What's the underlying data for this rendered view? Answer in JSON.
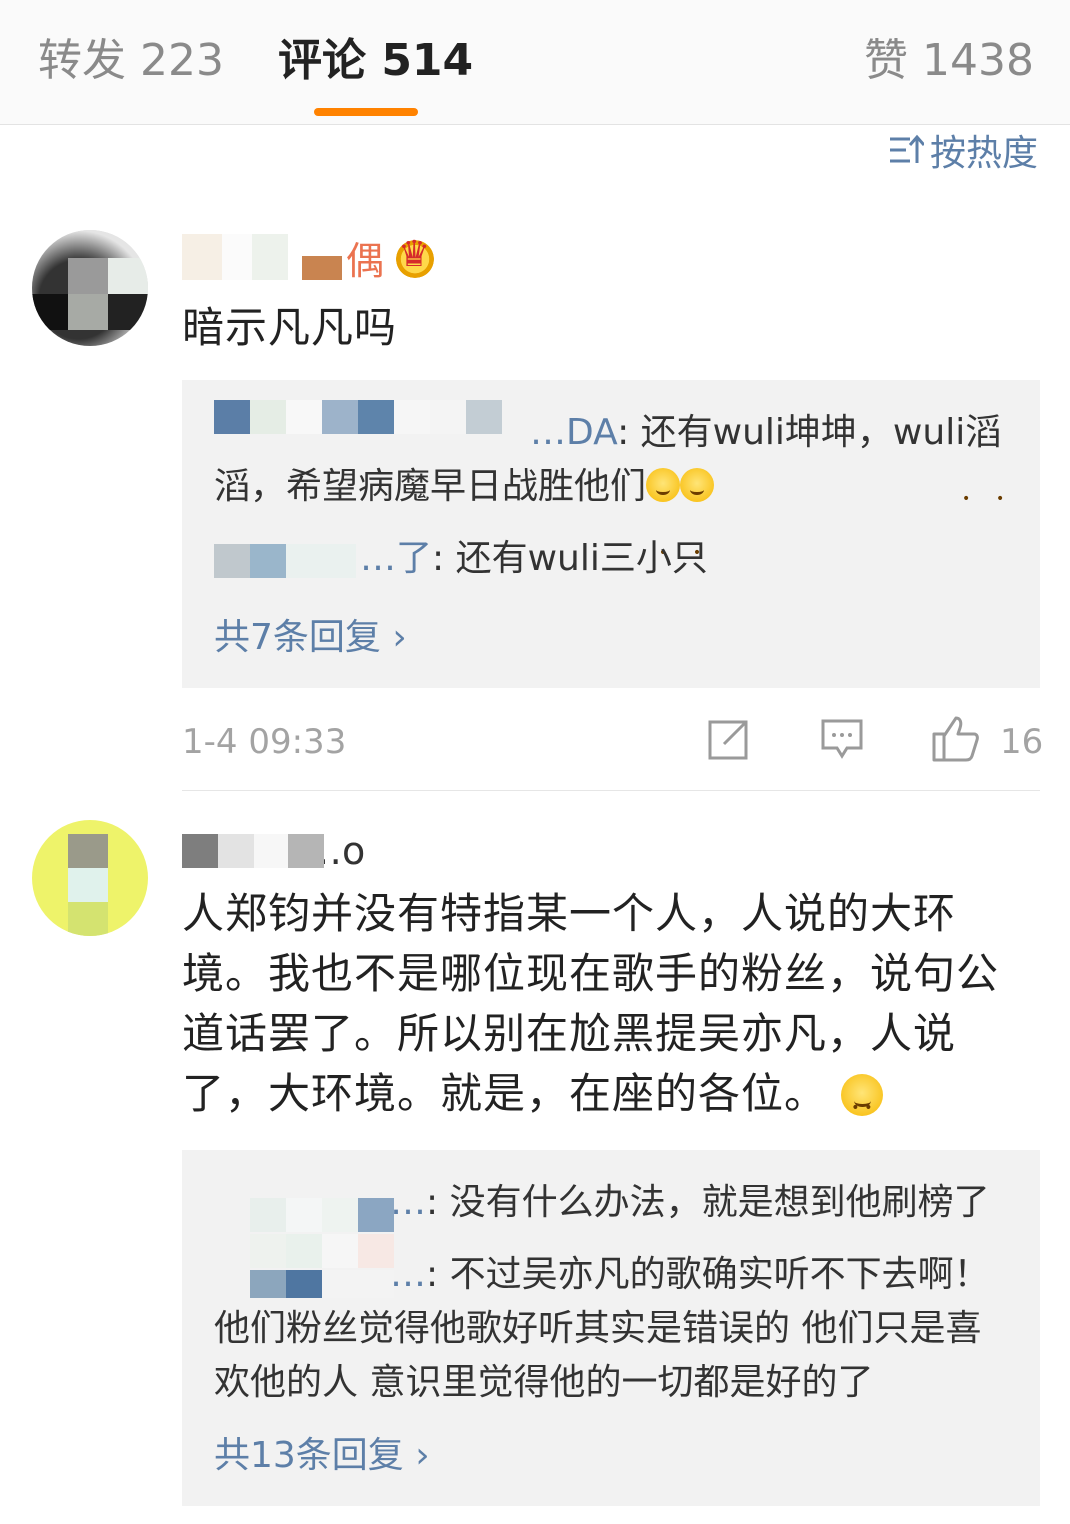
{
  "tabs": {
    "repost": "转发 223",
    "comments": "评论 514",
    "likes": "赞 1438"
  },
  "sort": {
    "label": "按热度",
    "icon": "sort-hot-icon"
  },
  "comments": [
    {
      "name": "…偶",
      "badge_icon": "crown-badge-icon",
      "text": "暗示凡凡吗",
      "replies": [
        {
          "name": "…DA",
          "text": ": 还有wuli坤坤，wuli滔滔，希望病魔早日战胜他们",
          "emoji": "shy-emoji-icon"
        },
        {
          "name": "…了",
          "text": ": 还有wuli三小只"
        }
      ],
      "more_replies": "共7条回复 ›",
      "time": "1-4 09:33",
      "likes": "16"
    },
    {
      "name": "…o",
      "text": "人郑钧并没有特指某一个人，人说的大环境。我也不是哪位现在歌手的粉丝，说句公道话罢了。所以别在尬黑提吴亦凡，人说了，大环境。就是，在座的各位。",
      "emoji": "smile-emoji-icon",
      "replies": [
        {
          "name": "…",
          "text": ": 没有什么办法，就是想到他刷榜了"
        },
        {
          "name": "…",
          "text": ": 不过吴亦凡的歌确实听不下去啊！他们粉丝觉得他歌好听其实是错误的 他们只是喜欢他的人 意识里觉得他的一切都是好的了"
        }
      ],
      "more_replies": "共13条回复 ›"
    }
  ],
  "colors": {
    "accent": "#ff8200",
    "link": "#5d7fa8",
    "name": "#eb7350"
  }
}
